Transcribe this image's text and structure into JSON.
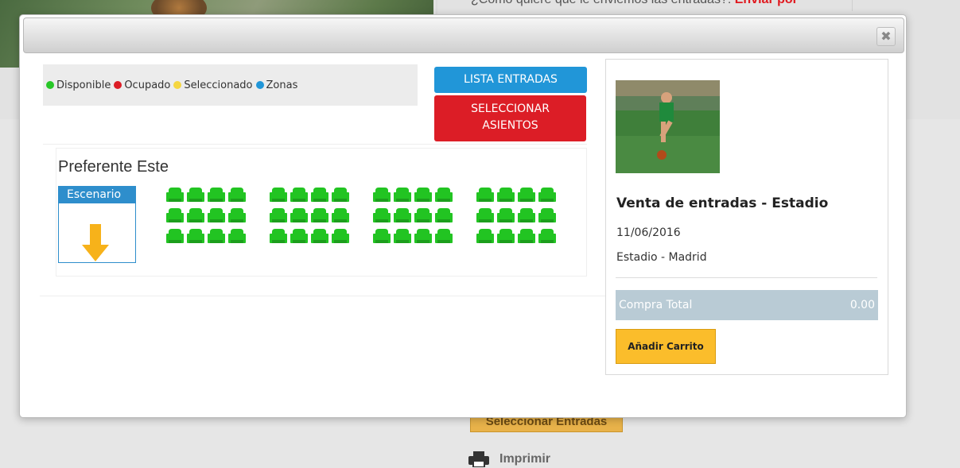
{
  "background": {
    "question_text": "¿Cómo quiere que le enviemos las entradas?:",
    "question_link": "Enviar por",
    "select_button": "Seleccionar Entradas",
    "print_label": "Imprimir"
  },
  "modal": {
    "close_symbol": "✖",
    "legend": [
      {
        "label": "Disponible",
        "color": "#28c728"
      },
      {
        "label": "Ocupado",
        "color": "#dc1d26"
      },
      {
        "label": "Seleccionado",
        "color": "#f5d640"
      },
      {
        "label": "Zonas",
        "color": "#2196d8"
      }
    ],
    "lista_button": "LISTA ENTRADAS",
    "asientos_button_line1": "SELECCIONAR",
    "asientos_button_line2": "ASIENTOS",
    "zone_title": "Preferente Este",
    "stage_label": "Escenario",
    "seat_color": "#22c422",
    "seat_blocks": 4,
    "seat_rows": 3,
    "seats_per_row": 4
  },
  "panel": {
    "event_title": "Venta de entradas - Estadio",
    "event_date": "11/06/2016",
    "event_place": "Estadio - Madrid",
    "total_label": "Compra Total",
    "total_value": "0.00",
    "cart_button": "Añadir Carrito"
  }
}
